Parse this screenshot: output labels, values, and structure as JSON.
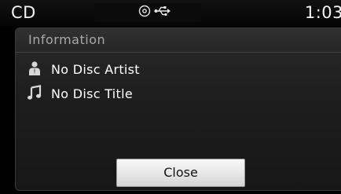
{
  "status_bar": {
    "source": "CD",
    "time": "1:03",
    "icons": [
      "disc-icon",
      "usb-icon"
    ]
  },
  "dialog": {
    "header": "Information",
    "rows": [
      {
        "icon": "person-icon",
        "label": "No Disc Artist"
      },
      {
        "icon": "music-note-icon",
        "label": "No Disc Title"
      }
    ],
    "close_label": "Close"
  },
  "colors": {
    "background": "#000000",
    "panel": "#1e1e1e",
    "header_text": "#a8a8a8",
    "text": "#ffffff",
    "button": "#e8e8e8"
  }
}
